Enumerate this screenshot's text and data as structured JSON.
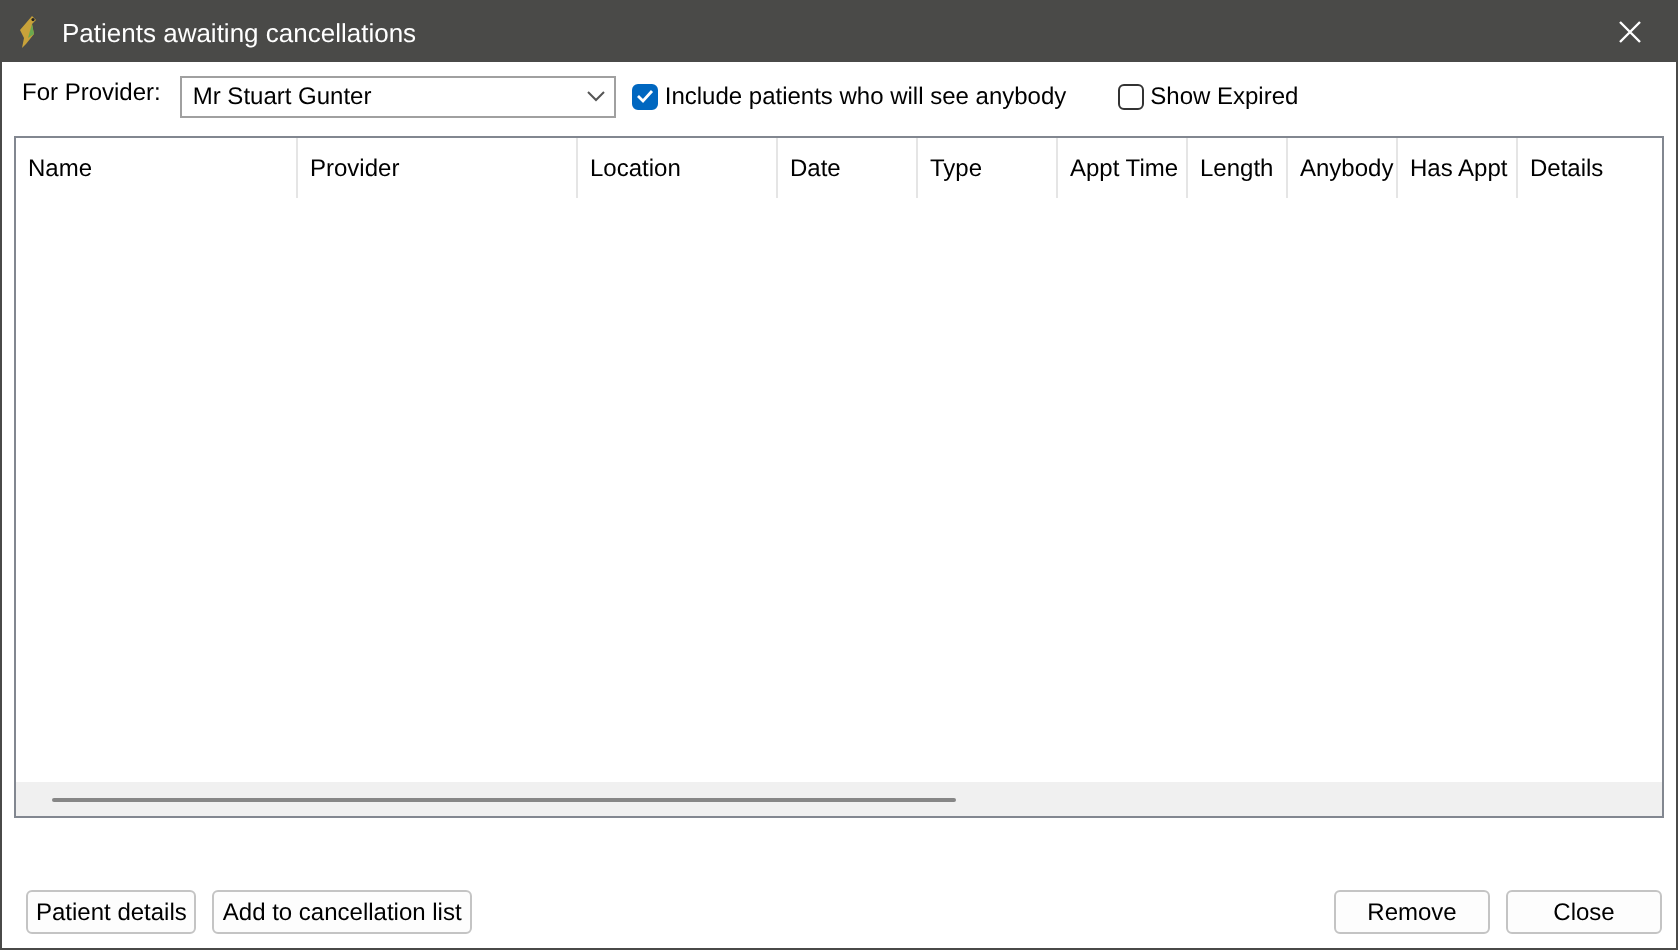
{
  "window": {
    "title": "Patients awaiting cancellations"
  },
  "provider": {
    "label": "For Provider:",
    "value": "Mr Stuart Gunter"
  },
  "options": [
    {
      "label": "Include patients who will see anybody",
      "checked": true
    },
    {
      "label": "Show Expired",
      "checked": false
    }
  ],
  "table": {
    "columns": [
      {
        "label": "Name"
      },
      {
        "label": "Provider"
      },
      {
        "label": "Location"
      },
      {
        "label": "Date"
      },
      {
        "label": "Type"
      },
      {
        "label": "Appt Time"
      },
      {
        "label": "Length"
      },
      {
        "label": "Anybody"
      },
      {
        "label": "Has Appt"
      },
      {
        "label": "Details"
      }
    ]
  },
  "left_buttons": [
    "Patient details",
    "Add to cancellation list"
  ],
  "right_buttons": [
    "Remove",
    "Close"
  ]
}
